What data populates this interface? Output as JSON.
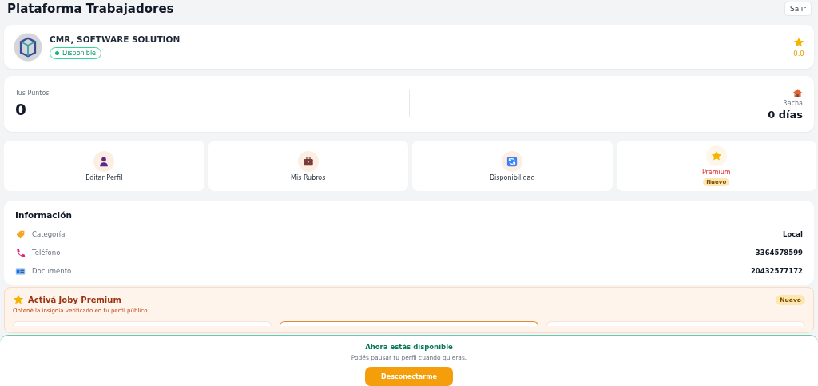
{
  "header": {
    "title": "Plataforma Trabajadores",
    "logout_button": "Salir"
  },
  "profile": {
    "name": "CMR, SOFTWARE SOLUTION",
    "status": "Disponible",
    "available": true,
    "rating": "0.0"
  },
  "stats": {
    "points_label": "Tus Puntos",
    "points": "0",
    "streak_label": "Racha",
    "streak": "0 días"
  },
  "actions": [
    {
      "label": "Editar Perfil",
      "highlight": false
    },
    {
      "label": "Mis Rubros",
      "highlight": false
    },
    {
      "label": "Disponibilidad",
      "highlight": false
    },
    {
      "label": "Premium",
      "highlight": true,
      "badge": "Nuevo"
    }
  ],
  "info": {
    "title": "Información",
    "rows": [
      {
        "label": "Categoría",
        "value": "Local"
      },
      {
        "label": "Teléfono",
        "value": "3364578599"
      },
      {
        "label": "Documento",
        "value": "20432577172"
      }
    ]
  },
  "premium": {
    "title": "Activá Joby Premium",
    "subtitle": "Obtené la insignia verificado en tu perfil público",
    "badge": "Nuevo",
    "plans": [
      {
        "selected": false
      },
      {
        "selected": true
      },
      {
        "selected": false
      }
    ]
  },
  "sheet": {
    "title": "Ahora estás disponible",
    "message": "Podés pausar tu perfil cuando quieras.",
    "button": "Desconectarme"
  }
}
